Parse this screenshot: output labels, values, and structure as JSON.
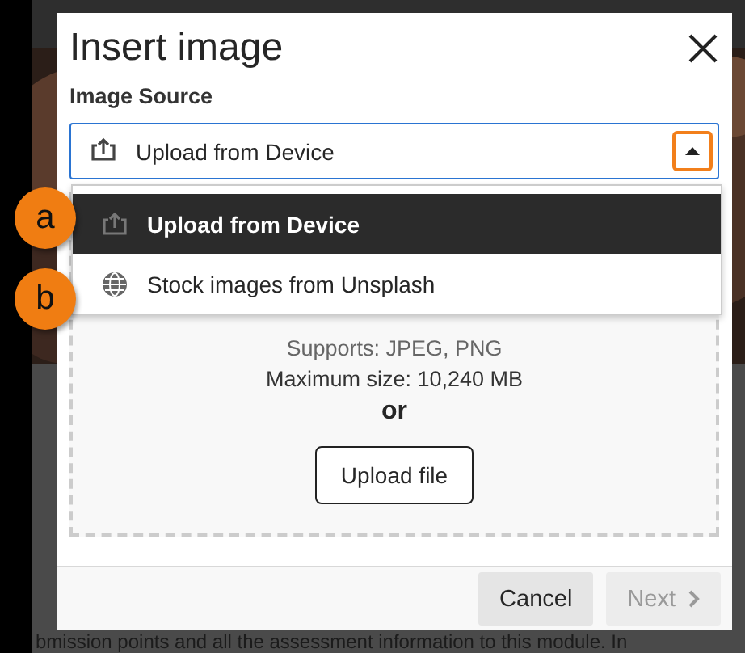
{
  "background_text": "bmission points and all the assessment information to this module. In",
  "dialog": {
    "title": "Insert image",
    "field_label": "Image Source",
    "select": {
      "value": "Upload from Device",
      "expanded": true
    },
    "options": [
      {
        "label": "Upload from Device",
        "kind": "upload",
        "selected": true,
        "callout": "a"
      },
      {
        "label": "Stock images from Unsplash",
        "kind": "globe",
        "selected": false,
        "callout": "b"
      }
    ],
    "drop_zone": {
      "supports": "Supports: JPEG, PNG",
      "max_size": "Maximum size: 10,240 MB",
      "separator": "or",
      "button": "Upload file"
    },
    "buttons": [
      {
        "label": "Cancel",
        "kind": "secondary",
        "disabled": false
      },
      {
        "label": "Next",
        "kind": "next",
        "disabled": true
      }
    ]
  }
}
